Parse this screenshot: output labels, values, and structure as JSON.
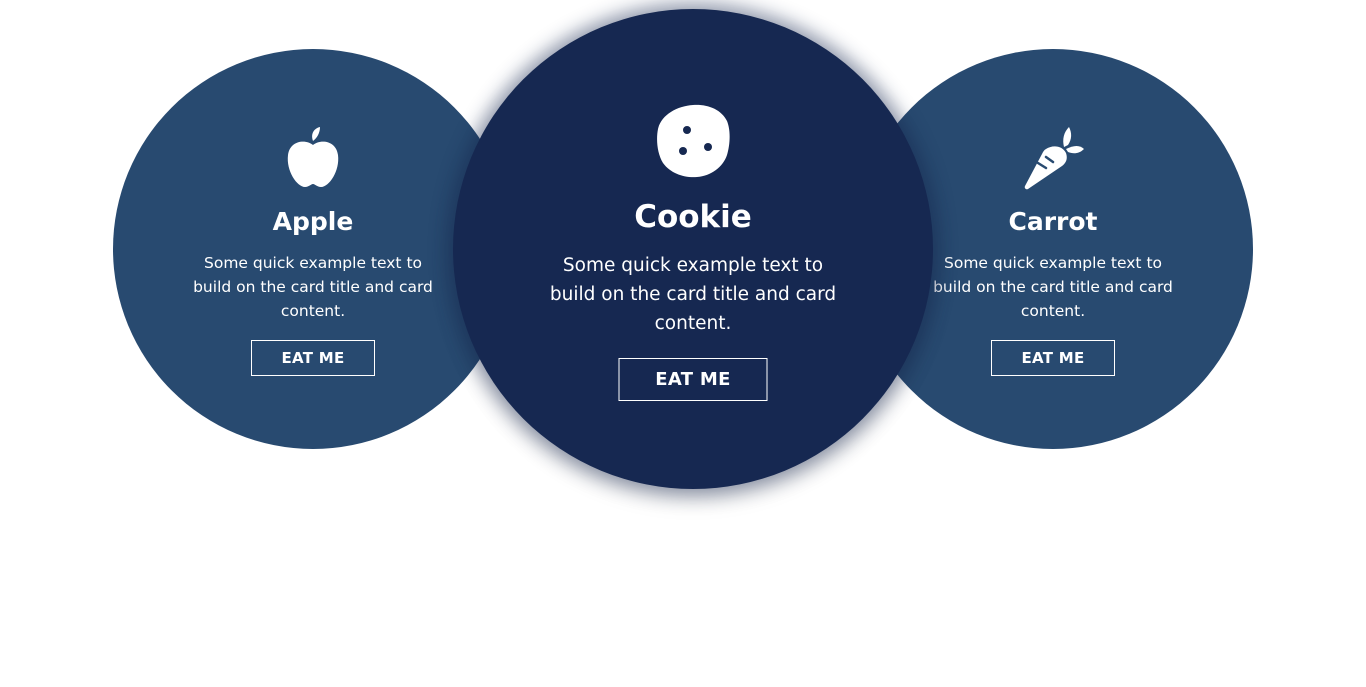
{
  "colors": {
    "side_card": "#284a70",
    "center_card": "#162851",
    "text": "#ffffff"
  },
  "cards": [
    {
      "icon": "apple-icon",
      "title": "Apple",
      "text": "Some quick example text to build on the card title and card content.",
      "button": "EAT ME"
    },
    {
      "icon": "cookie-icon",
      "title": "Cookie",
      "text": "Some quick example text to build on the card title and card content.",
      "button": "EAT ME"
    },
    {
      "icon": "carrot-icon",
      "title": "Carrot",
      "text": "Some quick example text to build on the card title and card content.",
      "button": "EAT ME"
    }
  ]
}
